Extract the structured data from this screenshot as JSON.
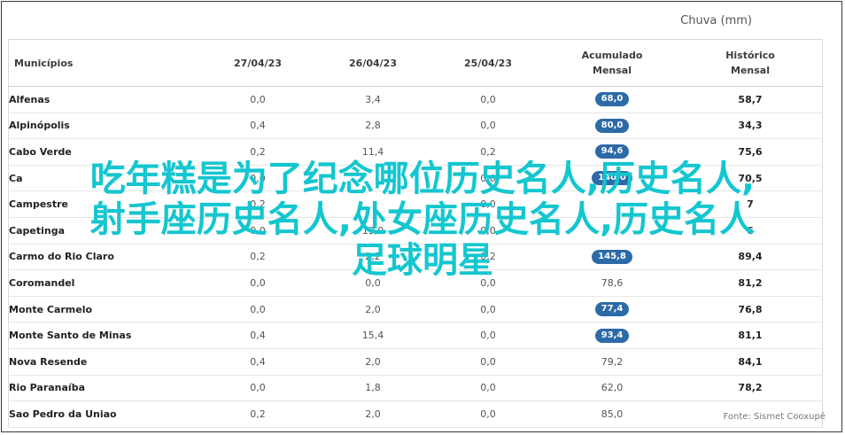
{
  "unit_label": "Chuva (mm)",
  "source": "Fonte: Sismet Cooxupé",
  "overlay_lines": [
    "吃年糕是为了纪念哪位历史名人,历史名人,",
    "射手座历史名人,处女座历史名人,历史名人",
    "足球明星"
  ],
  "headers": {
    "municipios": "Municípios",
    "d1": "27/04/23",
    "d2": "26/04/23",
    "d3": "25/04/23",
    "acum_l1": "Acumulado",
    "acum_l2": "Mensal",
    "hist_l1": "Histórico",
    "hist_l2": "Mensal"
  },
  "accent": "#2c6aa8",
  "rows": [
    {
      "name": "Alfenas",
      "d1": "0,0",
      "d2": "3,4",
      "d3": "0,0",
      "acum": "68,0",
      "acum_badge": true,
      "hist": "58,7"
    },
    {
      "name": "Alpinópolis",
      "d1": "0,4",
      "d2": "2,8",
      "d3": "0,0",
      "acum": "80,0",
      "acum_badge": true,
      "hist": "34,3"
    },
    {
      "name": "Cabo Verde",
      "d1": "0,2",
      "d2": "11,4",
      "d3": "0,2",
      "acum": "94,6",
      "acum_badge": true,
      "hist": "75,6"
    },
    {
      "name": "Ca",
      "d1": "0,0",
      "d2": "",
      "d3": "0,0",
      "acum": "140,0",
      "acum_badge": true,
      "hist": "70,5"
    },
    {
      "name": "Campestre",
      "d1": "0,2",
      "d2": "",
      "d3": "0,0",
      "acum": "",
      "acum_badge": true,
      "hist": "7"
    },
    {
      "name": "Capetinga",
      "d1": "0,0",
      "d2": "13,0",
      "d3": "0,0",
      "acum": "",
      "acum_badge": true,
      "hist": "6"
    },
    {
      "name": "Carmo do Rio Claro",
      "d1": "0,2",
      "d2": "2,2",
      "d3": "0,2",
      "acum": "145,8",
      "acum_badge": true,
      "hist": "89,4"
    },
    {
      "name": "Coromandel",
      "d1": "0,0",
      "d2": "0,0",
      "d3": "0,0",
      "acum": "78,6",
      "acum_badge": false,
      "hist": "81,2"
    },
    {
      "name": "Monte Carmelo",
      "d1": "0,0",
      "d2": "2,0",
      "d3": "0,0",
      "acum": "77,4",
      "acum_badge": true,
      "hist": "76,8"
    },
    {
      "name": "Monte Santo de Minas",
      "d1": "0,4",
      "d2": "15,4",
      "d3": "0,0",
      "acum": "93,4",
      "acum_badge": true,
      "hist": "81,1"
    },
    {
      "name": "Nova Resende",
      "d1": "0,4",
      "d2": "2,0",
      "d3": "0,0",
      "acum": "79,2",
      "acum_badge": false,
      "hist": "84,1"
    },
    {
      "name": "Rio Paranaíba",
      "d1": "0,0",
      "d2": "1,8",
      "d3": "0,0",
      "acum": "62,0",
      "acum_badge": false,
      "hist": "78,2"
    },
    {
      "name": "Sao Pedro da Uniao",
      "d1": "0,2",
      "d2": "2,0",
      "d3": "0,0",
      "acum": "85,0",
      "acum_badge": false,
      "hist": ""
    }
  ]
}
